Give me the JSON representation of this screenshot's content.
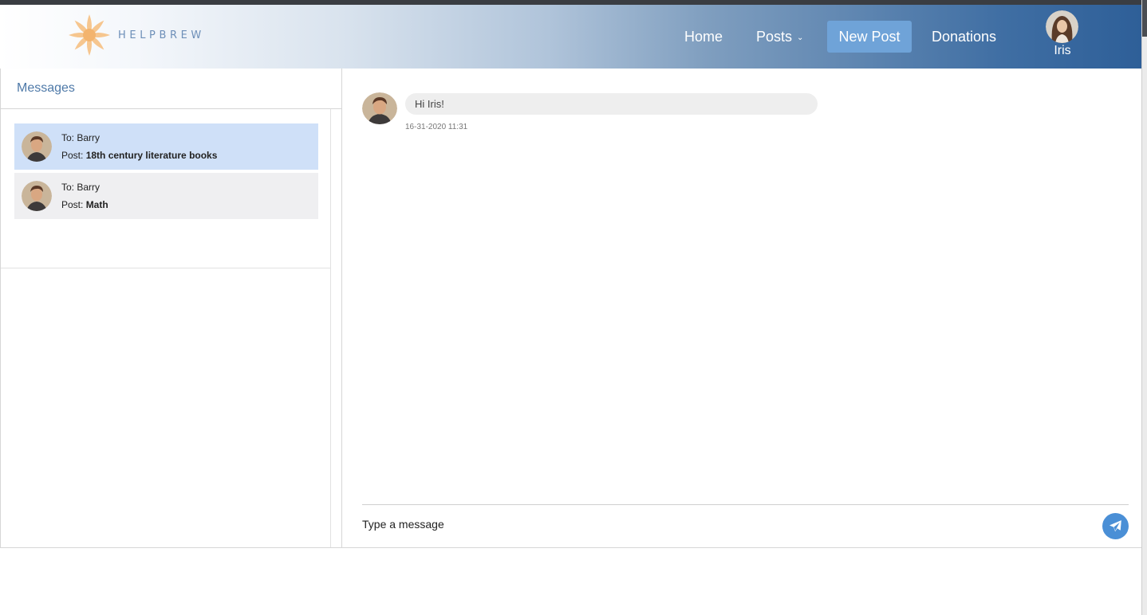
{
  "header": {
    "logo_text": "HELPBREW",
    "nav": {
      "home": "Home",
      "posts": "Posts",
      "new_post": "New Post",
      "donations": "Donations"
    },
    "user": {
      "name": "Iris"
    }
  },
  "icons": {
    "logo": "flower-icon",
    "posts_dropdown": "chevron-down-icon",
    "send": "paper-plane-icon"
  },
  "sidebar": {
    "title": "Messages",
    "conversations": [
      {
        "to": "To: Barry",
        "post_prefix": "Post: ",
        "post_title": "18th century literature books",
        "active": true
      },
      {
        "to": "To: Barry",
        "post_prefix": "Post: ",
        "post_title": "Math",
        "active": false
      }
    ]
  },
  "chat": {
    "messages": [
      {
        "text": "Hi Iris!",
        "timestamp": "16-31-2020 11:31"
      }
    ],
    "input": {
      "placeholder": "Type a message",
      "value": ""
    }
  },
  "colors": {
    "accent": "#6fa3d8",
    "link": "#4e79a8",
    "active_conversation": "#cfe0f8",
    "send_button": "#4a8fd6"
  }
}
